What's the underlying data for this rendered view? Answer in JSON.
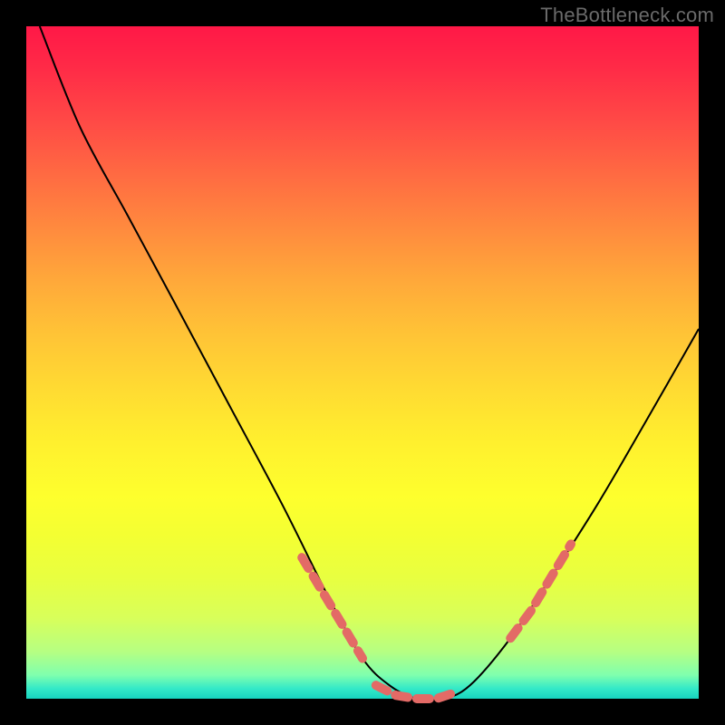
{
  "watermark": "TheBottleneck.com",
  "chart_data": {
    "type": "line",
    "title": "",
    "xlabel": "",
    "ylabel": "",
    "xlim": [
      0,
      100
    ],
    "ylim": [
      0,
      100
    ],
    "grid": false,
    "legend": false,
    "series": [
      {
        "name": "bottleneck-curve",
        "style": "solid",
        "color": "#000000",
        "x": [
          2,
          8,
          15,
          22,
          30,
          38,
          45,
          50,
          54,
          58,
          62,
          66,
          72,
          78,
          85,
          92,
          100
        ],
        "y": [
          100,
          85,
          72,
          59,
          44,
          29,
          15,
          6,
          2,
          0,
          0,
          2,
          9,
          18,
          29,
          41,
          55
        ]
      },
      {
        "name": "highlight-left-arm",
        "style": "dotted",
        "color": "#e36a66",
        "x": [
          41,
          44,
          47,
          50
        ],
        "y": [
          21,
          16,
          11,
          6
        ]
      },
      {
        "name": "highlight-floor",
        "style": "dotted",
        "color": "#e36a66",
        "x": [
          52,
          55,
          58,
          61,
          64
        ],
        "y": [
          2,
          0.5,
          0,
          0,
          1
        ]
      },
      {
        "name": "highlight-right-arm",
        "style": "dotted",
        "color": "#e36a66",
        "x": [
          72,
          75,
          78,
          81
        ],
        "y": [
          9,
          13,
          18,
          23
        ]
      }
    ]
  }
}
